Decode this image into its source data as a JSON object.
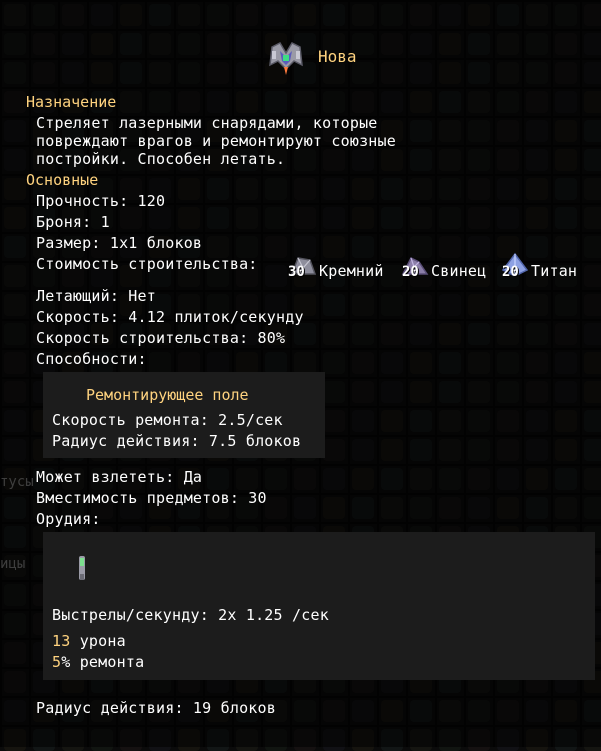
{
  "unit": {
    "name": "Нова",
    "icon": "nova-mech-icon"
  },
  "purpose": {
    "header": "Назначение",
    "description_lines": [
      "Стреляет лазерными снарядами, которые",
      "повреждают врагов и ремонтируют союзные",
      "постройки. Способен летать."
    ]
  },
  "general": {
    "header": "Основные",
    "health": "Прочность: 120",
    "armor": "Броня: 1",
    "size": "Размер: 1x1 блоков",
    "build_cost_label": "Стоимость строительства:",
    "build_cost": [
      {
        "amount": "30",
        "name": "Кремний",
        "icon": "silicon-icon",
        "color": "#8e8e9c"
      },
      {
        "amount": "20",
        "name": "Свинец",
        "icon": "lead-icon",
        "color": "#8c7fa9"
      },
      {
        "amount": "20",
        "name": "Титан",
        "icon": "titanium-icon",
        "color": "#8da1e3"
      }
    ],
    "flying": "Летающий: Нет",
    "speed": "Скорость: 4.12 плиток/секунду",
    "build_speed": "Скорость строительства: 80%",
    "abilities_label": "Способности:"
  },
  "ability": {
    "title": "Ремонтирующее поле",
    "repair_speed": "Скорость ремонта: 2.5/сек",
    "radius": "Радиус действия: 7.5 блоков"
  },
  "more": {
    "can_boost": "Может взлететь: Да",
    "item_capacity": "Вместимость предметов: 30",
    "weapons_label": "Орудия:"
  },
  "weapon": {
    "icon": "heal-laser-weapon-icon",
    "shots": "Выстрелы/секунду: 2x 1.25 /сек",
    "damage_value": "13",
    "damage_label": " урона",
    "repair_value": "5",
    "repair_label": "% ремонта"
  },
  "range": "Радиус действия: 19 блоков",
  "background_text": {
    "status_fragment": "тусы",
    "units_fragment": "ицы"
  }
}
